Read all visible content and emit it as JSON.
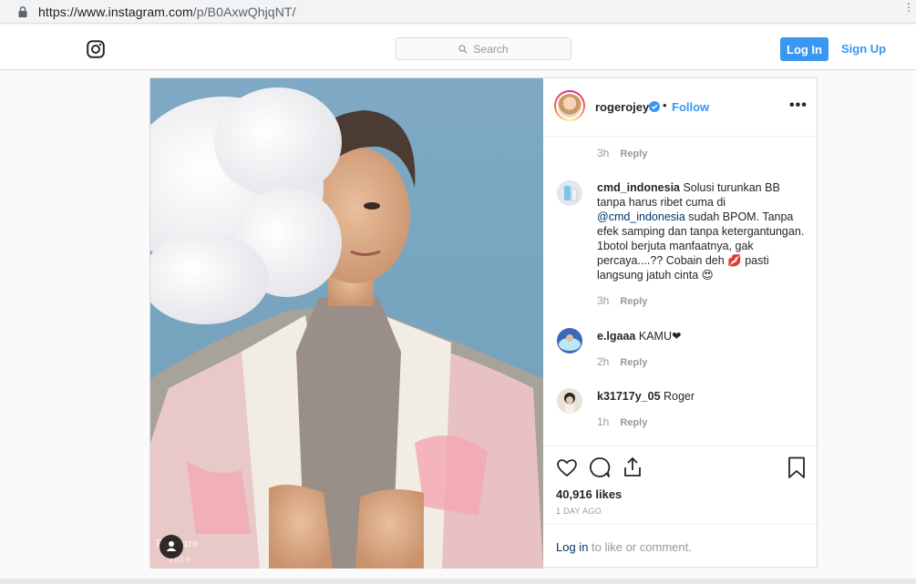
{
  "browser": {
    "url_host": "https://www.instagram.com",
    "url_path": "/p/B0AxwQhjqNT/"
  },
  "nav": {
    "search_placeholder": "Search",
    "login_label": "Log In",
    "signup_label": "Sign Up"
  },
  "post": {
    "username": "rogerojey",
    "separator": "•",
    "follow_label": "Follow",
    "more_label": "•••",
    "photo_watermark": "Pa    ature",
    "photo_watermark_year": "2019",
    "likes": "40,916 likes",
    "time_ago": "1 DAY AGO",
    "login_link": "Log in",
    "login_suffix": " to like or comment."
  },
  "comments": [
    {
      "time": "3h",
      "reply": "Reply"
    },
    {
      "username": "cmd_indonesia",
      "text_before": " Solusi turunkan BB tanpa harus ribet cuma di ",
      "mention": "@cmd_indonesia",
      "text_after": " sudah BPOM. Tanpa efek samping dan tanpa ketergantungan. 1botol berjuta manfaatnya, gak percaya....?? Cobain deh 💋 pasti langsung jatuh cinta 😍",
      "time": "3h",
      "reply": "Reply"
    },
    {
      "username": "e.lgaaa",
      "text": " KAMU❤",
      "time": "2h",
      "reply": "Reply"
    },
    {
      "username": "k31717y_05",
      "text": " Roger",
      "time": "1h",
      "reply": "Reply"
    }
  ],
  "colors": {
    "accent": "#3897f0",
    "link": "#003569",
    "muted": "#999999",
    "border": "#dbdbdb"
  }
}
